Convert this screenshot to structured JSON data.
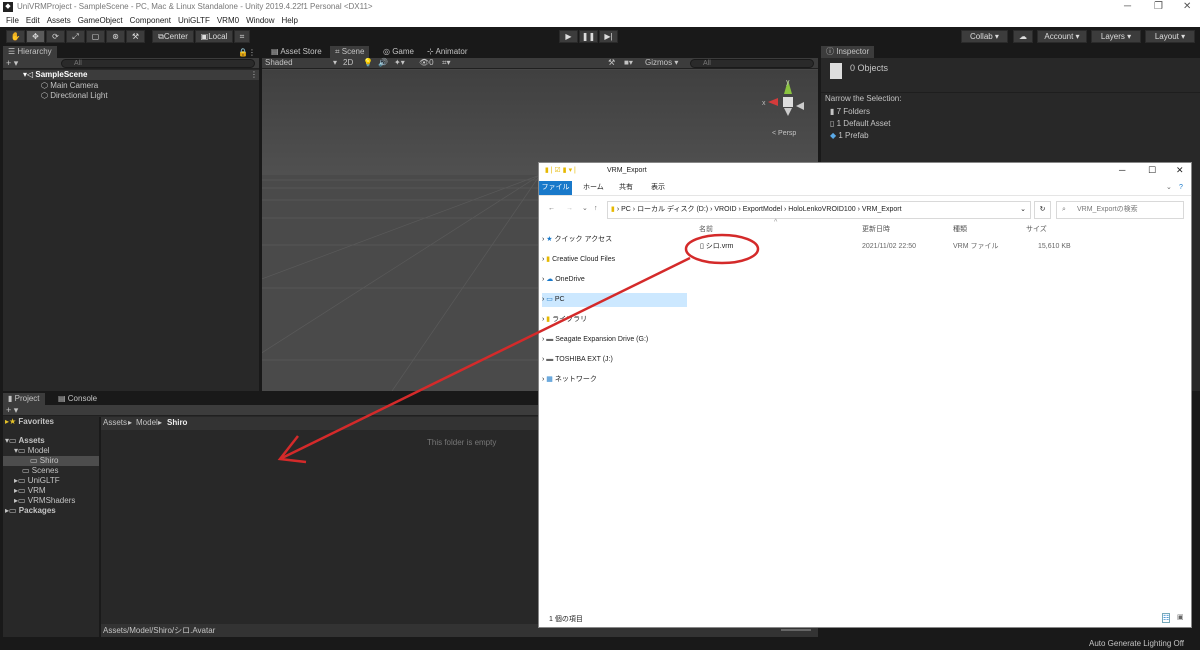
{
  "window": {
    "title": "UniVRMProject - SampleScene - PC, Mac & Linux Standalone - Unity 2019.4.22f1 Personal <DX11>"
  },
  "menu": [
    "File",
    "Edit",
    "Assets",
    "GameObject",
    "Component",
    "UniGLTF",
    "VRM0",
    "Window",
    "Help"
  ],
  "toolbar": {
    "center": "Center",
    "local": "Local",
    "collab": "Collab ▾",
    "account": "Account ▾",
    "layers": "Layers ▾",
    "layout": "Layout ▾"
  },
  "hierarchy": {
    "tab": "Hierarchy",
    "search": "All",
    "scene": "SampleScene",
    "items": [
      "Main Camera",
      "Directional Light"
    ]
  },
  "scene": {
    "tabs": [
      "Asset Store",
      "Scene",
      "Game",
      "Animator"
    ],
    "shading": "Shaded",
    "mode2d": "2D",
    "gizmos": "Gizmos",
    "search": "All",
    "persp": "< Persp",
    "fx_count": "0"
  },
  "inspector": {
    "tab": "Inspector",
    "count": "0 Objects",
    "narrow": "Narrow the Selection:",
    "items": [
      "7 Folders",
      "1 Default Asset",
      "1 Prefab"
    ]
  },
  "project": {
    "tabs": [
      "Project",
      "Console"
    ],
    "favorites": "Favorites",
    "assets": "Assets",
    "tree": [
      "Model",
      "Shiro",
      "Scenes",
      "UniGLTF",
      "VRM",
      "VRMShaders"
    ],
    "packages": "Packages",
    "breadcrumb": [
      "Assets",
      "Model",
      "Shiro"
    ],
    "empty": "This folder is empty",
    "path": "Assets/Model/Shiro/シロ.Avatar"
  },
  "status": {
    "lighting": "Auto Generate Lighting Off"
  },
  "explorer": {
    "title": "VRM_Export",
    "ribbon": [
      "ファイル",
      "ホーム",
      "共有",
      "表示"
    ],
    "path": [
      "PC",
      "ローカル ディスク (D:)",
      "VROID",
      "ExportModel",
      "HoloLenkoVROID100",
      "VRM_Export"
    ],
    "search": "VRM_Exportの検索",
    "columns": [
      "名前",
      "更新日時",
      "種類",
      "サイズ"
    ],
    "file": {
      "name": "シロ.vrm",
      "date": "2021/11/02 22:50",
      "type": "VRM ファイル",
      "size": "15,610 KB"
    },
    "nav": [
      "クイック アクセス",
      "Creative Cloud Files",
      "OneDrive",
      "PC",
      "ライブラリ",
      "Seagate Expansion Drive (G:)",
      "TOSHIBA EXT (J:)",
      "ネットワーク"
    ],
    "status": "1 個の項目"
  },
  "colors": {
    "annotation": "#d42a2a",
    "selection": "#cce8ff",
    "ribbon_active": "#1979ca"
  }
}
